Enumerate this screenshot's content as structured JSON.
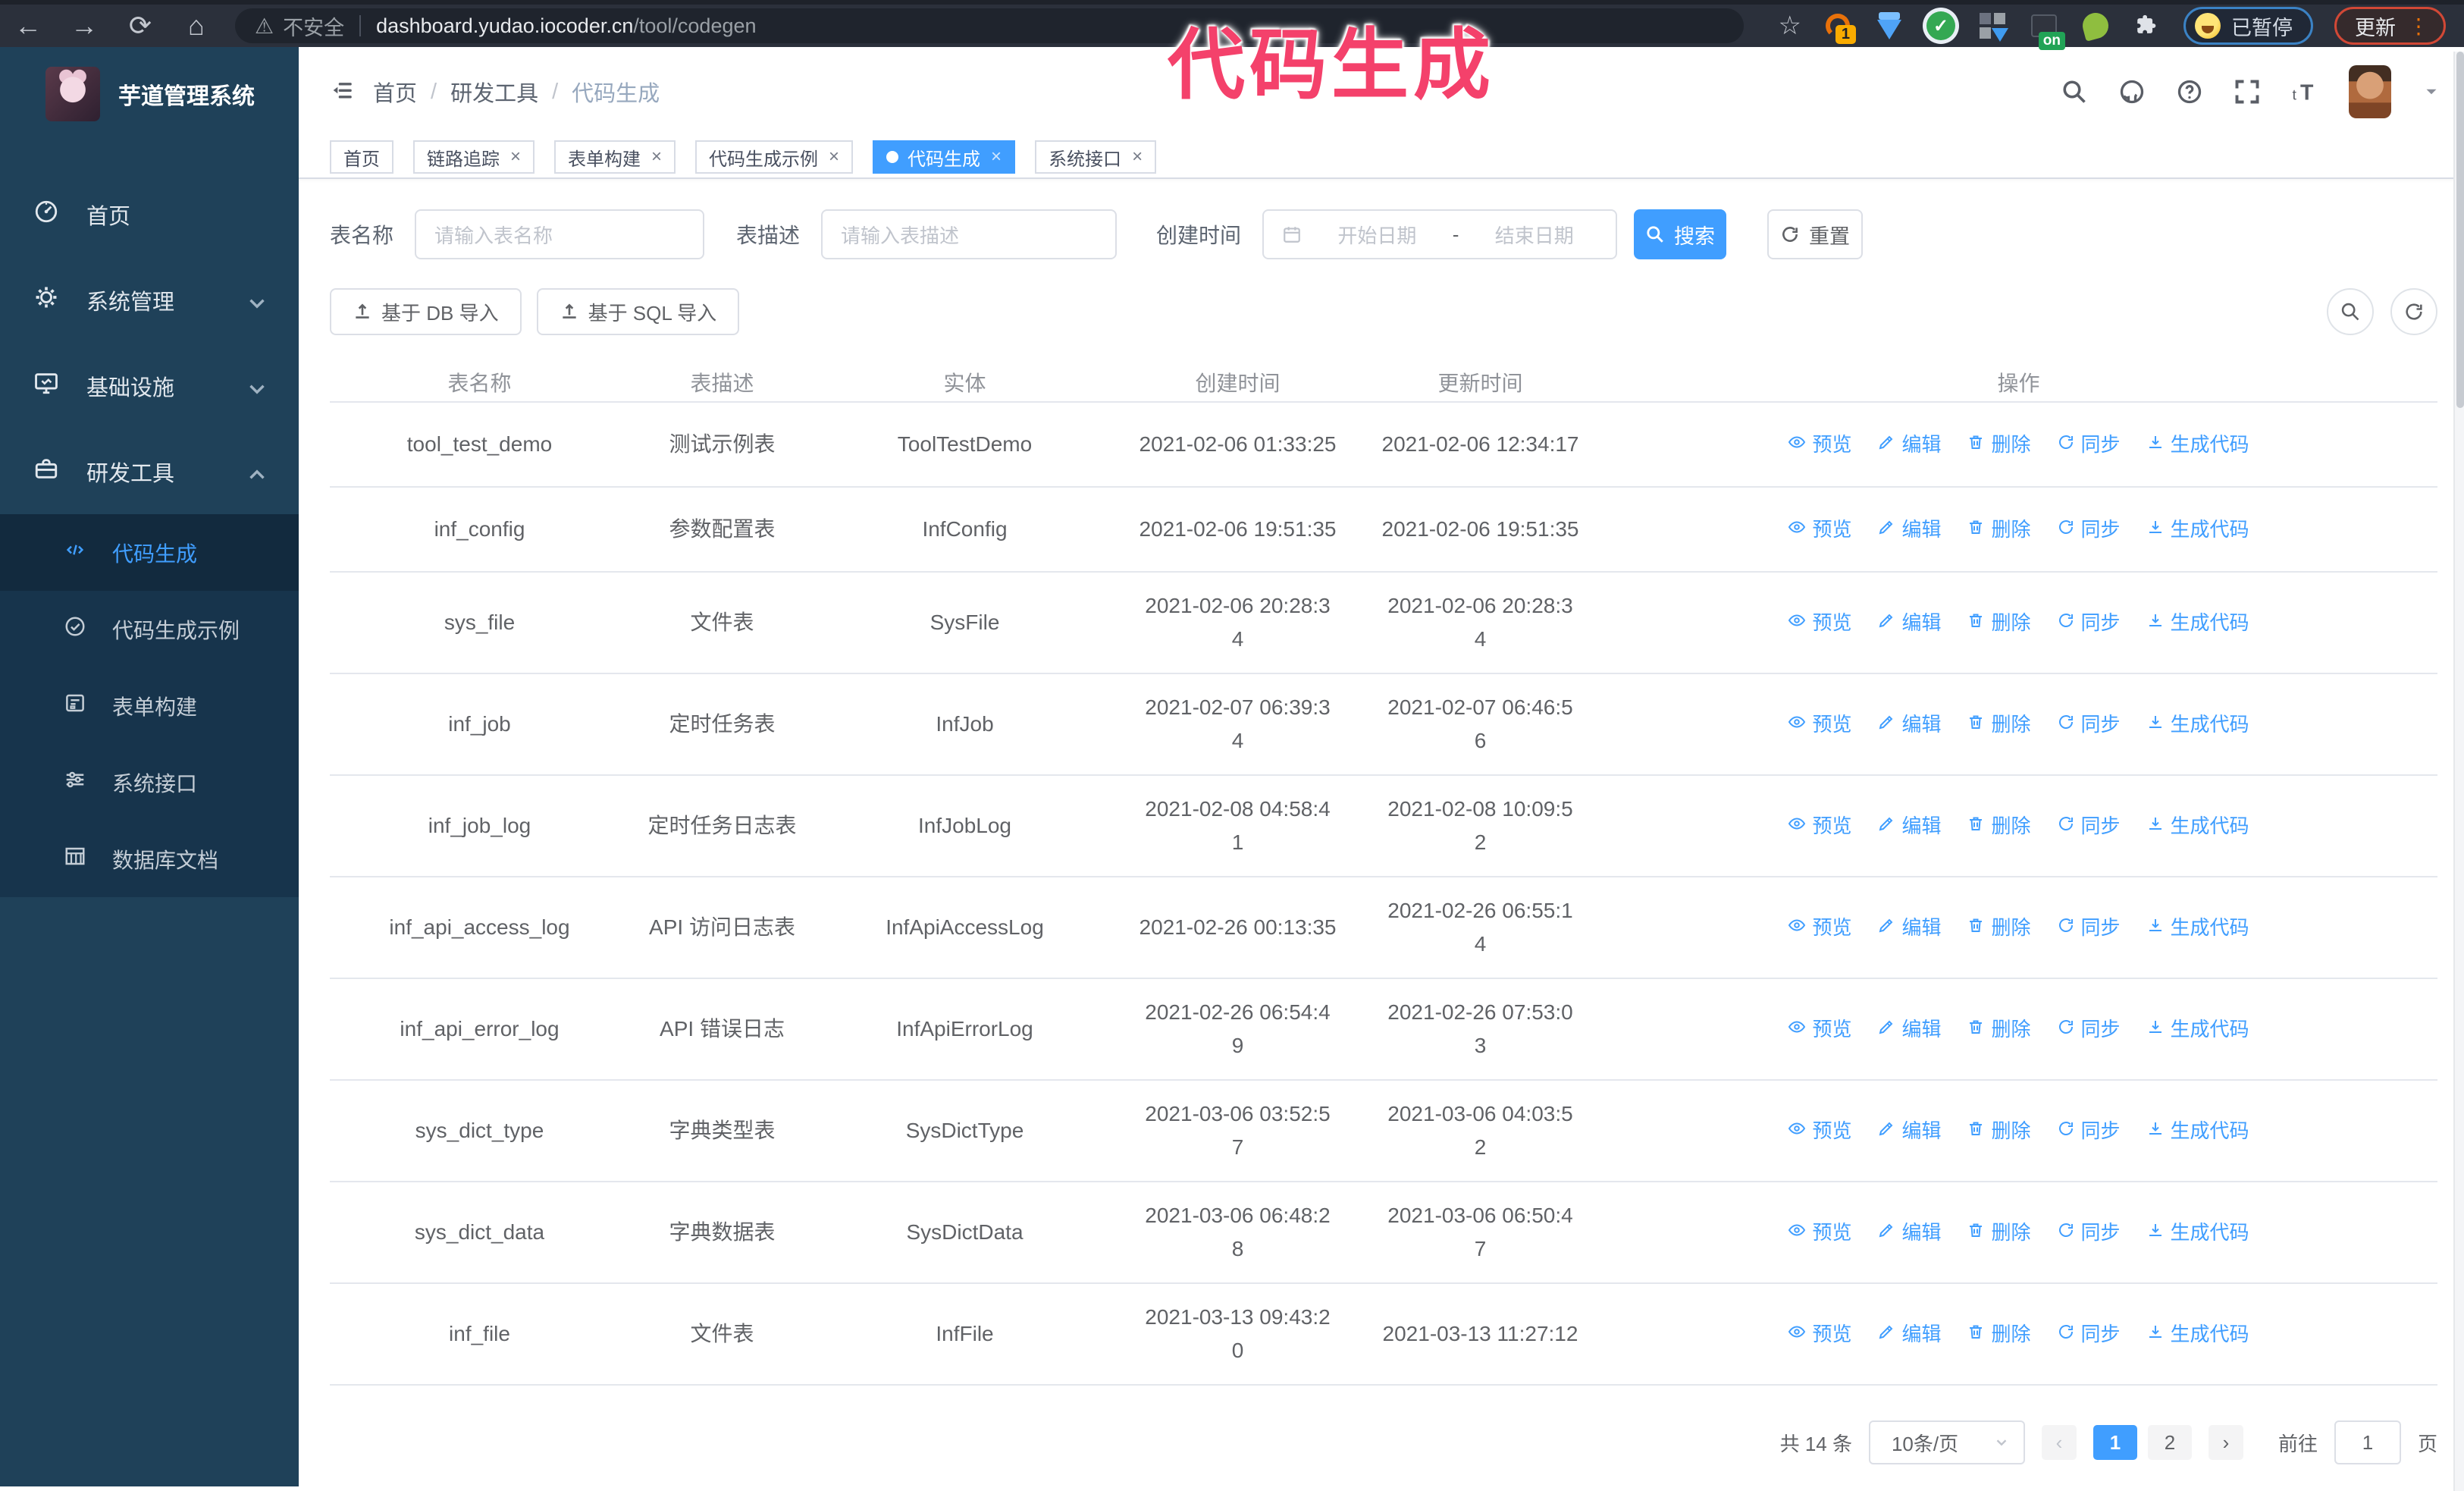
{
  "browser": {
    "insecure_label": "不安全",
    "url_domain": "dashboard.yudao.iocoder.cn",
    "url_path": "/tool/codegen",
    "extension_badge_one": "1",
    "extension_badge_on": "on",
    "paused_label": "已暂停",
    "update_label": "更新"
  },
  "annotation": {
    "text": "代码生成",
    "color": "#f4416b"
  },
  "sidebar": {
    "app_title": "芋道管理系统",
    "menu": [
      {
        "label": "首页",
        "icon": "dashboard-icon",
        "arrow": ""
      },
      {
        "label": "系统管理",
        "icon": "gear-icon",
        "arrow": "down"
      },
      {
        "label": "基础设施",
        "icon": "monitor-icon",
        "arrow": "down"
      },
      {
        "label": "研发工具",
        "icon": "toolbox-icon",
        "arrow": "up"
      }
    ],
    "submenu": [
      {
        "label": "代码生成",
        "icon": "code-icon",
        "active": true
      },
      {
        "label": "代码生成示例",
        "icon": "circle-check-icon",
        "active": false
      },
      {
        "label": "表单构建",
        "icon": "form-icon",
        "active": false
      },
      {
        "label": "系统接口",
        "icon": "sliders-icon",
        "active": false
      },
      {
        "label": "数据库文档",
        "icon": "db-table-icon",
        "active": false
      }
    ]
  },
  "breadcrumb": [
    "首页",
    "研发工具",
    "代码生成"
  ],
  "tags": [
    {
      "label": "首页",
      "closable": false,
      "active": false
    },
    {
      "label": "链路追踪",
      "closable": true,
      "active": false
    },
    {
      "label": "表单构建",
      "closable": true,
      "active": false
    },
    {
      "label": "代码生成示例",
      "closable": true,
      "active": false
    },
    {
      "label": "代码生成",
      "closable": true,
      "active": true
    },
    {
      "label": "系统接口",
      "closable": true,
      "active": false
    }
  ],
  "filters": {
    "table_name_label": "表名称",
    "table_name_placeholder": "请输入表名称",
    "table_desc_label": "表描述",
    "table_desc_placeholder": "请输入表描述",
    "create_time_label": "创建时间",
    "date_start_placeholder": "开始日期",
    "date_separator": "-",
    "date_end_placeholder": "结束日期",
    "search_button": "搜索",
    "reset_button": "重置"
  },
  "toolbar": {
    "import_db_button": "基于 DB 导入",
    "import_sql_button": "基于 SQL 导入"
  },
  "table": {
    "columns": [
      "表名称",
      "表描述",
      "实体",
      "创建时间",
      "更新时间",
      "操作"
    ],
    "actions": [
      {
        "label": "预览",
        "icon": "eye-icon"
      },
      {
        "label": "编辑",
        "icon": "edit-icon"
      },
      {
        "label": "删除",
        "icon": "trash-icon"
      },
      {
        "label": "同步",
        "icon": "sync-icon"
      },
      {
        "label": "生成代码",
        "icon": "download-icon"
      }
    ],
    "rows": [
      {
        "name": "tool_test_demo",
        "desc": "测试示例表",
        "entity": "ToolTestDemo",
        "created": [
          "2021-02-06 01:33:25"
        ],
        "updated": [
          "2021-02-06 12:34:17"
        ]
      },
      {
        "name": "inf_config",
        "desc": "参数配置表",
        "entity": "InfConfig",
        "created": [
          "2021-02-06 19:51:35"
        ],
        "updated": [
          "2021-02-06 19:51:35"
        ]
      },
      {
        "name": "sys_file",
        "desc": "文件表",
        "entity": "SysFile",
        "created": [
          "2021-02-06 20:28:3",
          "4"
        ],
        "updated": [
          "2021-02-06 20:28:3",
          "4"
        ]
      },
      {
        "name": "inf_job",
        "desc": "定时任务表",
        "entity": "InfJob",
        "created": [
          "2021-02-07 06:39:3",
          "4"
        ],
        "updated": [
          "2021-02-07 06:46:5",
          "6"
        ]
      },
      {
        "name": "inf_job_log",
        "desc": "定时任务日志表",
        "entity": "InfJobLog",
        "created": [
          "2021-02-08 04:58:4",
          "1"
        ],
        "updated": [
          "2021-02-08 10:09:5",
          "2"
        ]
      },
      {
        "name": "inf_api_access_log",
        "desc": "API 访问日志表",
        "entity": "InfApiAccessLog",
        "created": [
          "2021-02-26 00:13:35"
        ],
        "updated": [
          "2021-02-26 06:55:1",
          "4"
        ]
      },
      {
        "name": "inf_api_error_log",
        "desc": "API 错误日志",
        "entity": "InfApiErrorLog",
        "created": [
          "2021-02-26 06:54:4",
          "9"
        ],
        "updated": [
          "2021-02-26 07:53:0",
          "3"
        ]
      },
      {
        "name": "sys_dict_type",
        "desc": "字典类型表",
        "entity": "SysDictType",
        "created": [
          "2021-03-06 03:52:5",
          "7"
        ],
        "updated": [
          "2021-03-06 04:03:5",
          "2"
        ]
      },
      {
        "name": "sys_dict_data",
        "desc": "字典数据表",
        "entity": "SysDictData",
        "created": [
          "2021-03-06 06:48:2",
          "8"
        ],
        "updated": [
          "2021-03-06 06:50:4",
          "7"
        ]
      },
      {
        "name": "inf_file",
        "desc": "文件表",
        "entity": "InfFile",
        "created": [
          "2021-03-13 09:43:2",
          "0"
        ],
        "updated": [
          "2021-03-13 11:27:12"
        ]
      }
    ]
  },
  "pagination": {
    "total_text": "共 14 条",
    "page_size_value": "10条/页",
    "pages": [
      "1",
      "2"
    ],
    "active_page": "1",
    "prev_icon": "chevron-left-icon",
    "next_icon": "chevron-right-icon",
    "goto_label": "前往",
    "goto_value": "1",
    "goto_suffix": "页"
  },
  "colors": {
    "accent_blue": "#409eff",
    "annotation_pink": "#f4416b",
    "sidebar_bg": "#1f4159",
    "submenu_bg": "#17344c",
    "browser_bar_bg": "#2b303b",
    "paused_outline": "#3b82c4",
    "update_outline": "#d14836",
    "table_header_text": "#909399",
    "table_cell_text": "#606266"
  }
}
